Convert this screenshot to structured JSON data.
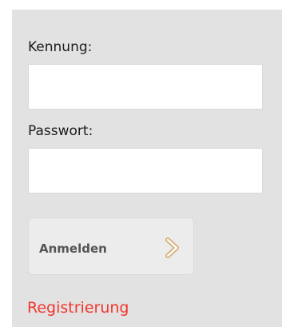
{
  "form": {
    "username_label": "Kennung:",
    "username_value": "",
    "password_label": "Passwort:",
    "password_value": "",
    "submit_label": "Anmelden",
    "submit_icon": "chevron-right-icon",
    "register_link": "Registrierung"
  },
  "colors": {
    "panel_background": "#e2e2e2",
    "button_background": "#ececec",
    "register_link": "#f2362c",
    "chevron_outline": "#d9b07a"
  }
}
